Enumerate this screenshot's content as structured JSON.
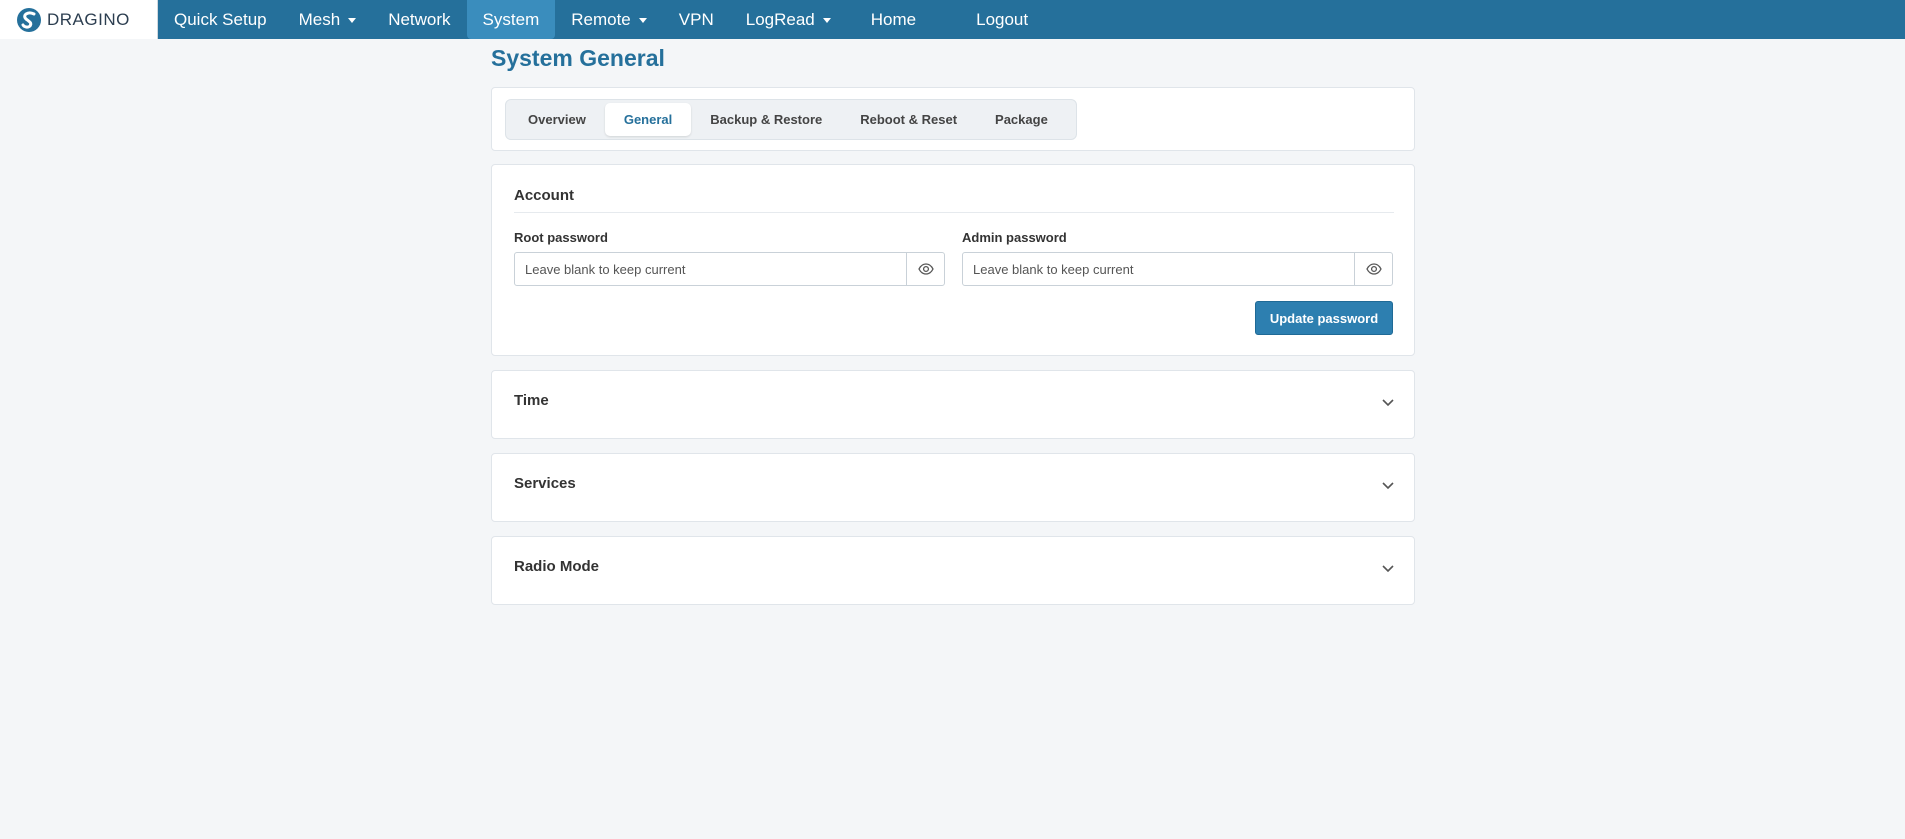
{
  "navbar": {
    "logo_text": "DRAGINO",
    "items": [
      {
        "label": "Quick Setup",
        "dropdown": false,
        "active": false
      },
      {
        "label": "Mesh",
        "dropdown": true,
        "active": false
      },
      {
        "label": "Network",
        "dropdown": false,
        "active": false
      },
      {
        "label": "System",
        "dropdown": false,
        "active": true
      },
      {
        "label": "Remote",
        "dropdown": true,
        "active": false
      },
      {
        "label": "VPN",
        "dropdown": false,
        "active": false
      },
      {
        "label": "LogRead",
        "dropdown": true,
        "active": false
      },
      {
        "label": "Home",
        "dropdown": false,
        "active": false
      },
      {
        "label": "Logout",
        "dropdown": false,
        "active": false
      }
    ]
  },
  "page": {
    "title": "System General"
  },
  "tabs": [
    {
      "label": "Overview",
      "active": false
    },
    {
      "label": "General",
      "active": true
    },
    {
      "label": "Backup & Restore",
      "active": false
    },
    {
      "label": "Reboot & Reset",
      "active": false
    },
    {
      "label": "Package",
      "active": false
    }
  ],
  "account": {
    "title": "Account",
    "root_label": "Root password",
    "root_placeholder": "Leave blank to keep current",
    "root_value": "",
    "admin_label": "Admin password",
    "admin_placeholder": "Leave blank to keep current",
    "admin_value": "",
    "update_button": "Update password"
  },
  "sections": [
    {
      "title": "Time",
      "expanded": false
    },
    {
      "title": "Services",
      "expanded": false
    },
    {
      "title": "Radio Mode",
      "expanded": false
    }
  ],
  "colors": {
    "brand": "#25709b",
    "active_nav": "#3a8dbd",
    "button": "#2d7fb0",
    "background": "#f4f6f8"
  },
  "icons": {
    "logo": "dragino-logo-icon",
    "dropdown": "caret-down-icon",
    "reveal": "eye-icon",
    "expand": "chevron-down-icon"
  }
}
